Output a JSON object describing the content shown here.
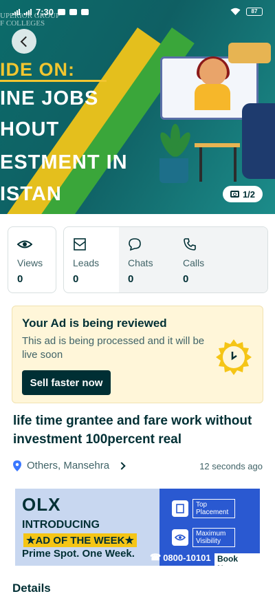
{
  "status_bar": {
    "time": "7:30",
    "battery": "87"
  },
  "banner": {
    "watermark_line1": "UPERIOR GROUP",
    "watermark_line2": "F COLLEGES",
    "lines": [
      "IDE ON:",
      "INE JOBS",
      "HOUT",
      "ESTMENT IN",
      "ISTAN"
    ],
    "photo_counter": "1/2"
  },
  "stats": {
    "views": {
      "label": "Views",
      "value": "0"
    },
    "leads": {
      "label": "Leads",
      "value": "0"
    },
    "chats": {
      "label": "Chats",
      "value": "0"
    },
    "calls": {
      "label": "Calls",
      "value": "0"
    }
  },
  "review": {
    "title": "Your Ad is being reviewed",
    "description": "This ad is being processed and it will be live soon",
    "button": "Sell faster now"
  },
  "ad": {
    "title": "life time grantee and fare work without investment 100percent real",
    "location": "Others, Mansehra",
    "posted": "12 seconds ago"
  },
  "promo": {
    "logo": "OLX",
    "introducing": "INTRODUCING",
    "ad_of_week": "★AD OF THE WEEK★",
    "tagline": "Prime Spot. One Week.",
    "feature1": "Top Placement",
    "feature2": "Maximum Visibility",
    "phone": "0800-10101",
    "book": "Book Now"
  },
  "details_heading": "Details",
  "colors": {
    "primary": "#002f34",
    "review_bg": "#fff6d9",
    "promo_blue": "#2a59d1",
    "promo_yellow": "#f5c516"
  }
}
